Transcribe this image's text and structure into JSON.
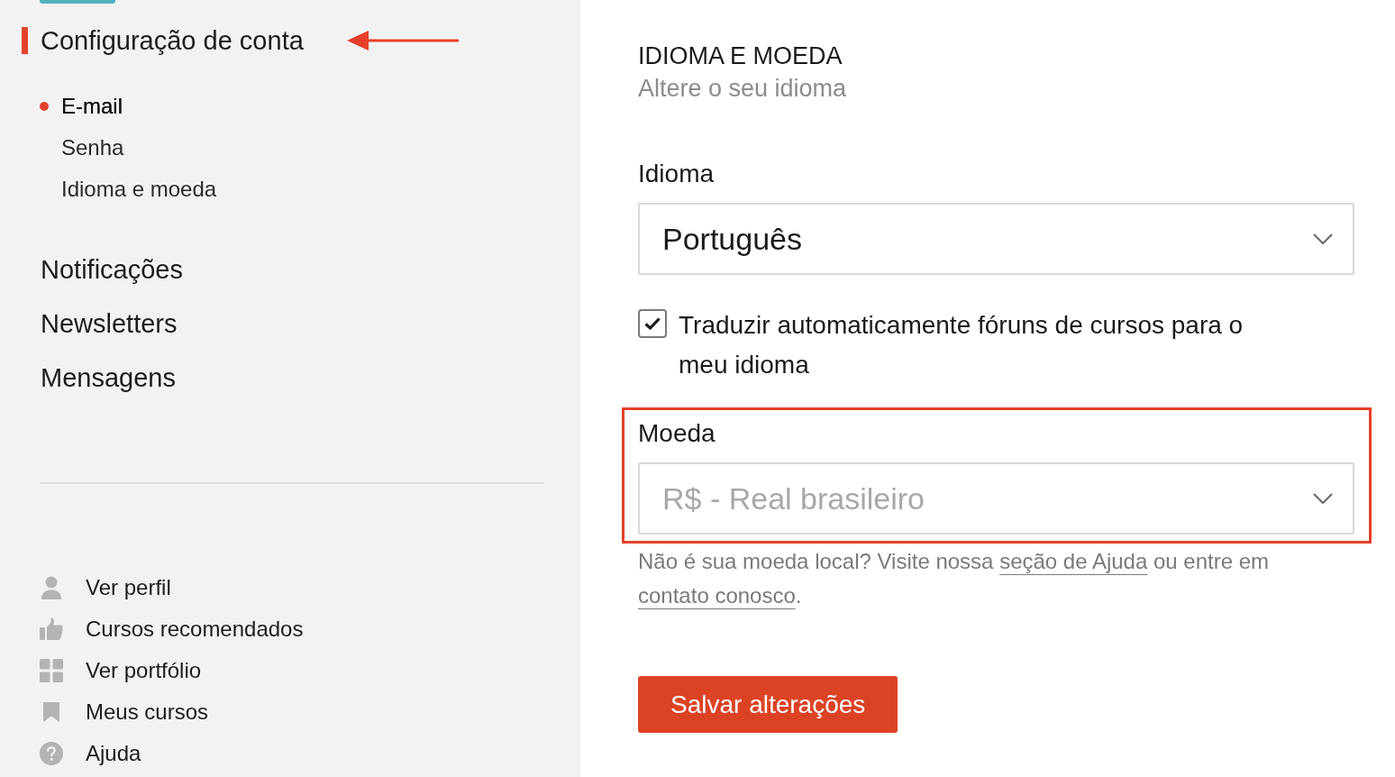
{
  "sidebar": {
    "sections": [
      {
        "label": "Configuração de conta",
        "selected": true,
        "annotated": true,
        "children": [
          {
            "label": "E-mail",
            "selected": true
          },
          {
            "label": "Senha",
            "selected": false
          },
          {
            "label": "Idioma e moeda",
            "selected": false
          }
        ]
      },
      {
        "label": "Notificações",
        "selected": false,
        "annotated": false
      },
      {
        "label": "Newsletters",
        "selected": false,
        "annotated": false
      },
      {
        "label": "Mensagens",
        "selected": false,
        "annotated": false
      }
    ],
    "links": [
      "Ver perfil",
      "Cursos recomendados",
      "Ver portfólio",
      "Meus cursos",
      "Ajuda"
    ]
  },
  "main": {
    "title": "IDIOMA E MOEDA",
    "subtitle": "Altere o seu idioma",
    "language": {
      "label": "Idioma",
      "value": "Português",
      "disabled": false
    },
    "auto_translate": {
      "label": "Traduzir automaticamente fóruns de cursos para o meu idioma",
      "checked": true
    },
    "currency": {
      "label": "Moeda",
      "value": "R$ - Real brasileiro",
      "disabled": true,
      "highlighted": true
    },
    "currency_help": [
      {
        "kind": "text",
        "text": "Não é sua moeda local? Visite nossa "
      },
      {
        "kind": "link",
        "text": "seção de Ajuda"
      },
      {
        "kind": "text",
        "text": " ou entre em "
      },
      {
        "kind": "link",
        "text": "contato conosco"
      },
      {
        "kind": "text",
        "text": "."
      }
    ],
    "save_button": "Salvar alterações"
  }
}
